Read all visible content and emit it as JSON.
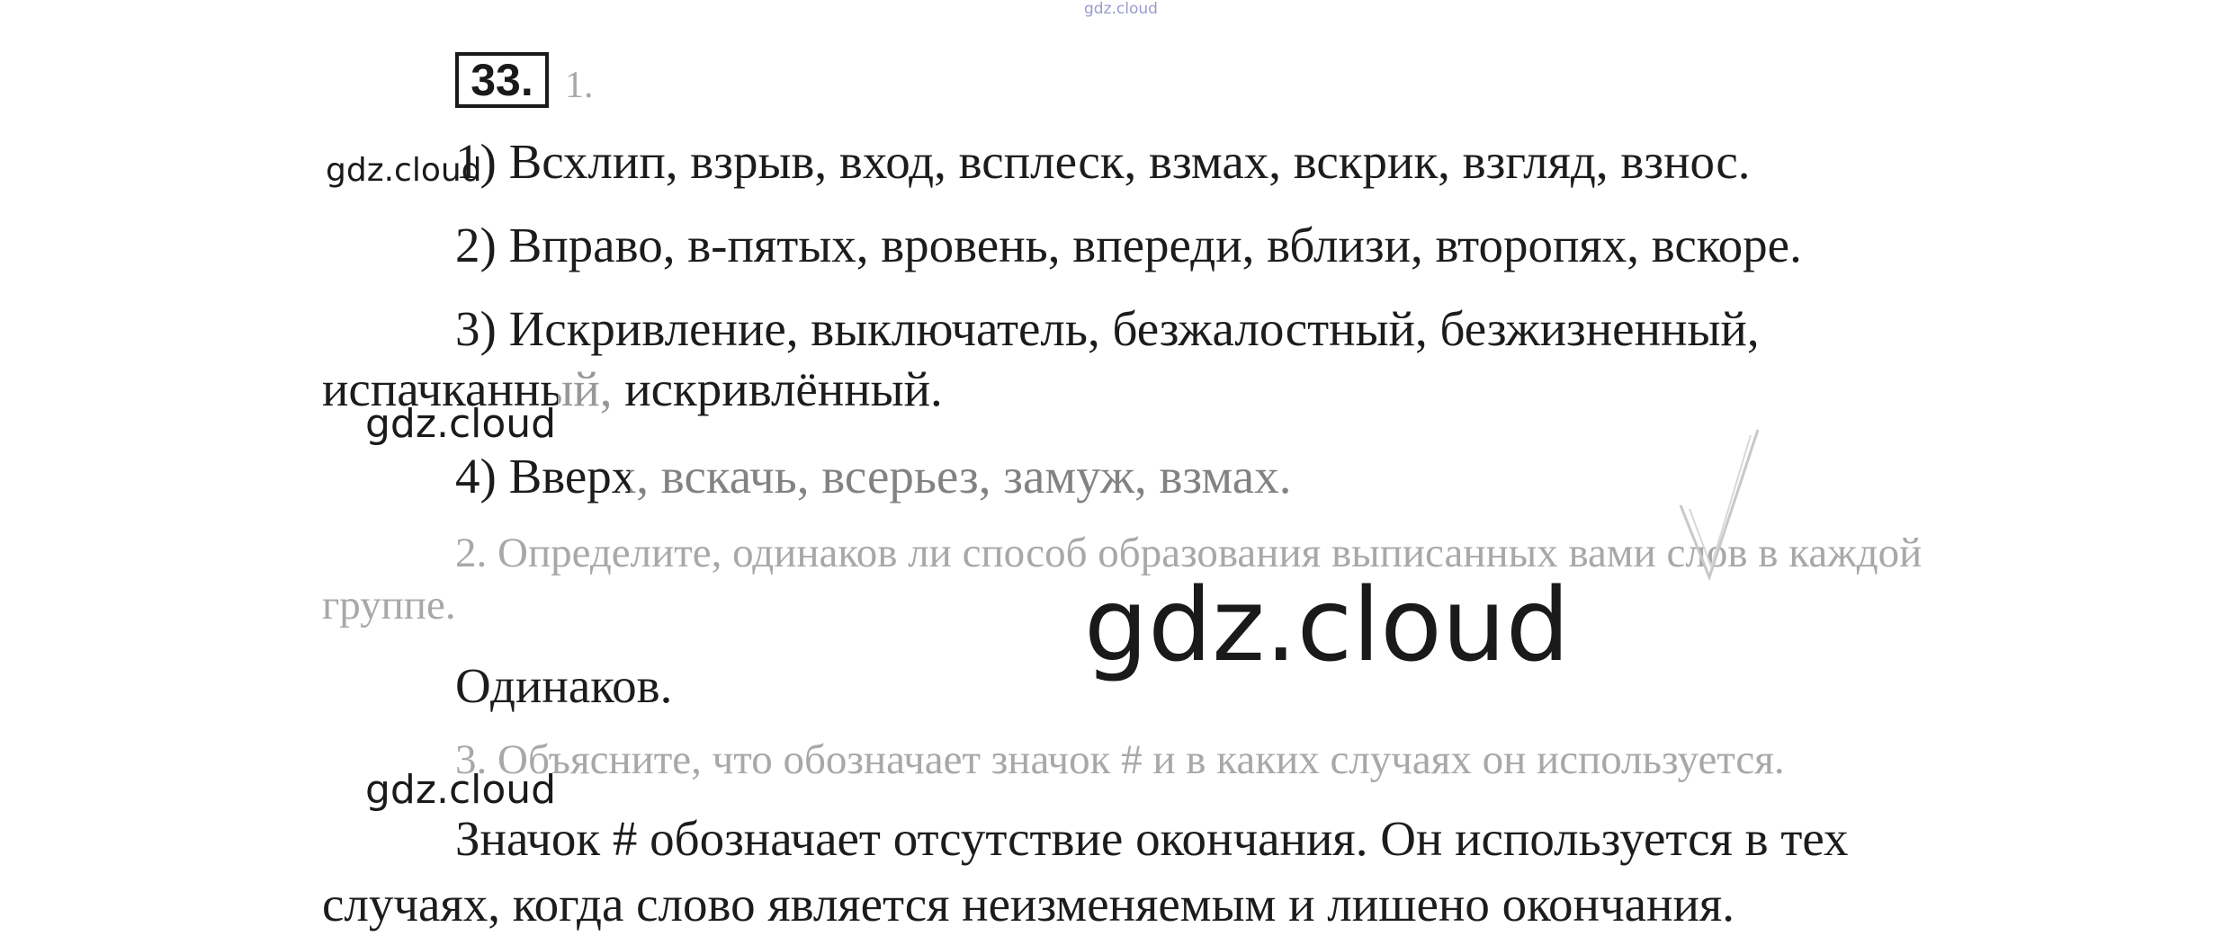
{
  "watermark": {
    "site": "gdz.cloud",
    "site_top": "gdz.cloud"
  },
  "exercise": {
    "number": "33.",
    "task1_number": "1.",
    "lines": [
      "1) Всхлип, взрыв, вход, всплеск, взмах, вскрик, взгляд, взнос.",
      "2) Вправо, в-пятых, вровень, впереди, вблизи, второпях, вскоре.",
      "3) Искривление, выключатель, безжалостный, безжизненный,",
      "испачканный, искривлённый.",
      "4) Вверх, вскачь, всерьез, замуж, взмах."
    ],
    "task2_line1": "2. Определите, одинаков ли способ образования выписанных вами слов в каждой",
    "task2_line2": "группе.",
    "answer2": "Одинаков.",
    "task3": "3. Объясните, что обозначает значок # и в каких случаях он используется.",
    "answer3_line1": "Значок # обозначает отсутствие окончания. Он используется в тех",
    "answer3_line2": "случаях, когда слово является неизменяемым и лишено окончания."
  }
}
